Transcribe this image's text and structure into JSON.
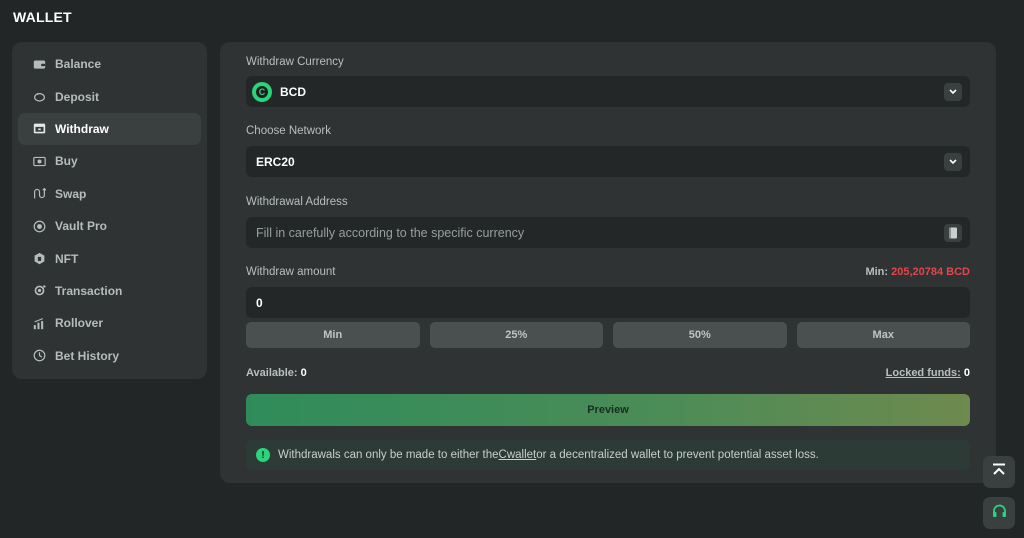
{
  "page": {
    "title": "WALLET"
  },
  "sidebar": {
    "items": [
      {
        "label": "Balance",
        "icon": "wallet-icon",
        "active": false
      },
      {
        "label": "Deposit",
        "icon": "piggy-bank-icon",
        "active": false
      },
      {
        "label": "Withdraw",
        "icon": "withdraw-icon",
        "active": true
      },
      {
        "label": "Buy",
        "icon": "cash-icon",
        "active": false
      },
      {
        "label": "Swap",
        "icon": "swap-icon",
        "active": false
      },
      {
        "label": "Vault Pro",
        "icon": "vault-icon",
        "active": false
      },
      {
        "label": "NFT",
        "icon": "nft-icon",
        "active": false
      },
      {
        "label": "Transaction",
        "icon": "transaction-icon",
        "active": false
      },
      {
        "label": "Rollover",
        "icon": "rollover-icon",
        "active": false
      },
      {
        "label": "Bet History",
        "icon": "clock-icon",
        "active": false
      }
    ]
  },
  "withdraw": {
    "currency_label": "Withdraw Currency",
    "currency_value": "BCD",
    "currency_icon_letter": "C",
    "network_label": "Choose Network",
    "network_value": "ERC20",
    "address_label": "Withdrawal Address",
    "address_placeholder": "Fill in carefully according to the specific currency",
    "amount_label": "Withdraw amount",
    "amount_value": "0",
    "min_label": "Min:",
    "min_value": "205,20784 BCD",
    "quick_buttons": [
      "Min",
      "25%",
      "50%",
      "Max"
    ],
    "available_label": "Available:",
    "available_value": "0",
    "locked_label": "Locked funds:",
    "locked_value": "0",
    "preview_label": "Preview",
    "notice_before": "Withdrawals can only be made to either the ",
    "notice_link": "Cwallet",
    "notice_after": "or a decentralized wallet to prevent potential asset loss."
  },
  "colors": {
    "accent": "#2bd47a",
    "danger": "#e5454a"
  }
}
